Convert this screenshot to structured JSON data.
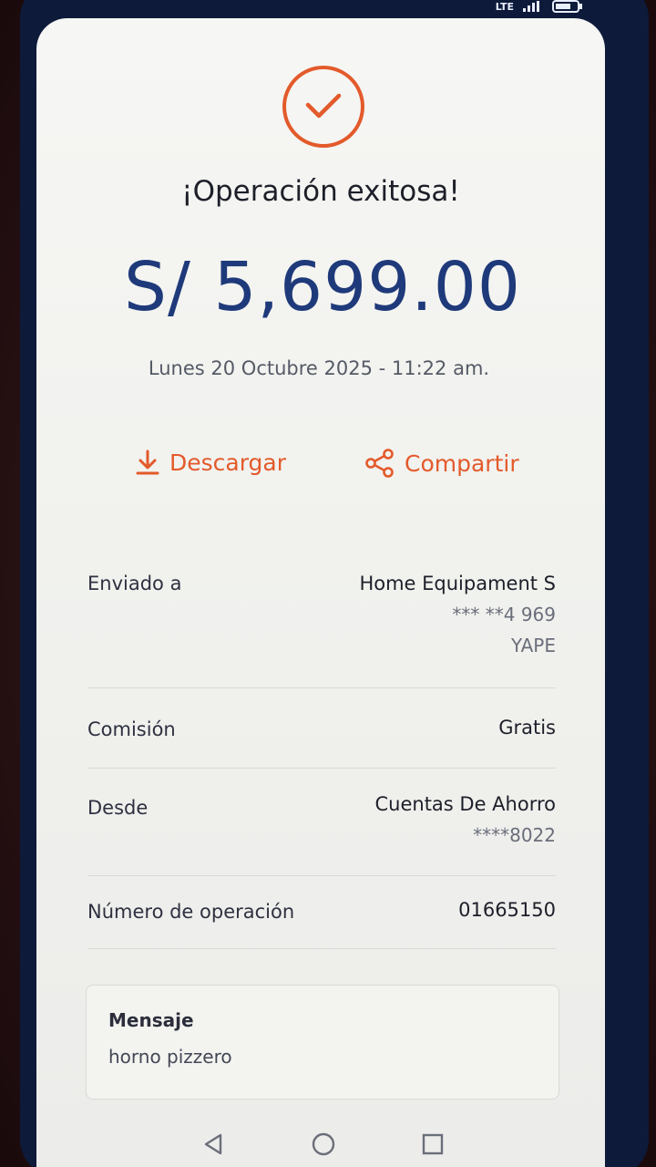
{
  "status_bar": {
    "network": "LTE"
  },
  "receipt": {
    "status_title": "¡Operación exitosa!",
    "amount": "S/ 5,699.00",
    "datetime": "Lunes 20 Octubre 2025 - 11:22 am.",
    "download_label": "Descargar",
    "share_label": "Compartir"
  },
  "details": {
    "sent_to": {
      "label": "Enviado a",
      "name": "Home Equipament S",
      "phone": "*** **4 969",
      "channel": "YAPE"
    },
    "commission": {
      "label": "Comisión",
      "value": "Gratis"
    },
    "from": {
      "label": "Desde",
      "account": "Cuentas De Ahorro",
      "number": "****8022"
    },
    "operation": {
      "label": "Número de operación",
      "value": "01665150"
    }
  },
  "message": {
    "title": "Mensaje",
    "text": "horno pizzero"
  },
  "colors": {
    "accent": "#e35a2b",
    "amount": "#1f3a7a",
    "frame": "#0d1a3a"
  },
  "icons": [
    "check-icon",
    "download-icon",
    "share-icon",
    "back-icon",
    "home-icon",
    "recents-icon"
  ]
}
